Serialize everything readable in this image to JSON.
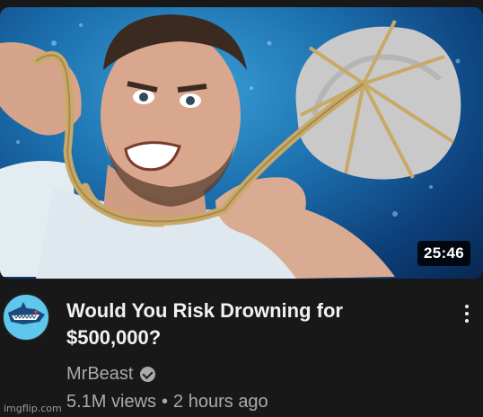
{
  "video": {
    "title_line1": "Would You Risk Drowning for",
    "title_line2": "$500,000?",
    "duration": "25:46",
    "channel": "MrBeast",
    "views": "5.1M views",
    "separator": "•",
    "age": "2 hours ago"
  },
  "icons": {
    "verified": "verified-check-icon",
    "menu": "more-vert-icon",
    "avatar": "channel-avatar-icon"
  },
  "watermark": "imgflip.com",
  "colors": {
    "background": "#181818",
    "title": "#f1f1f1",
    "secondary_text": "#aaaaaa",
    "water": "#1c6fae",
    "avatar_bg": "#5fc6ec"
  }
}
